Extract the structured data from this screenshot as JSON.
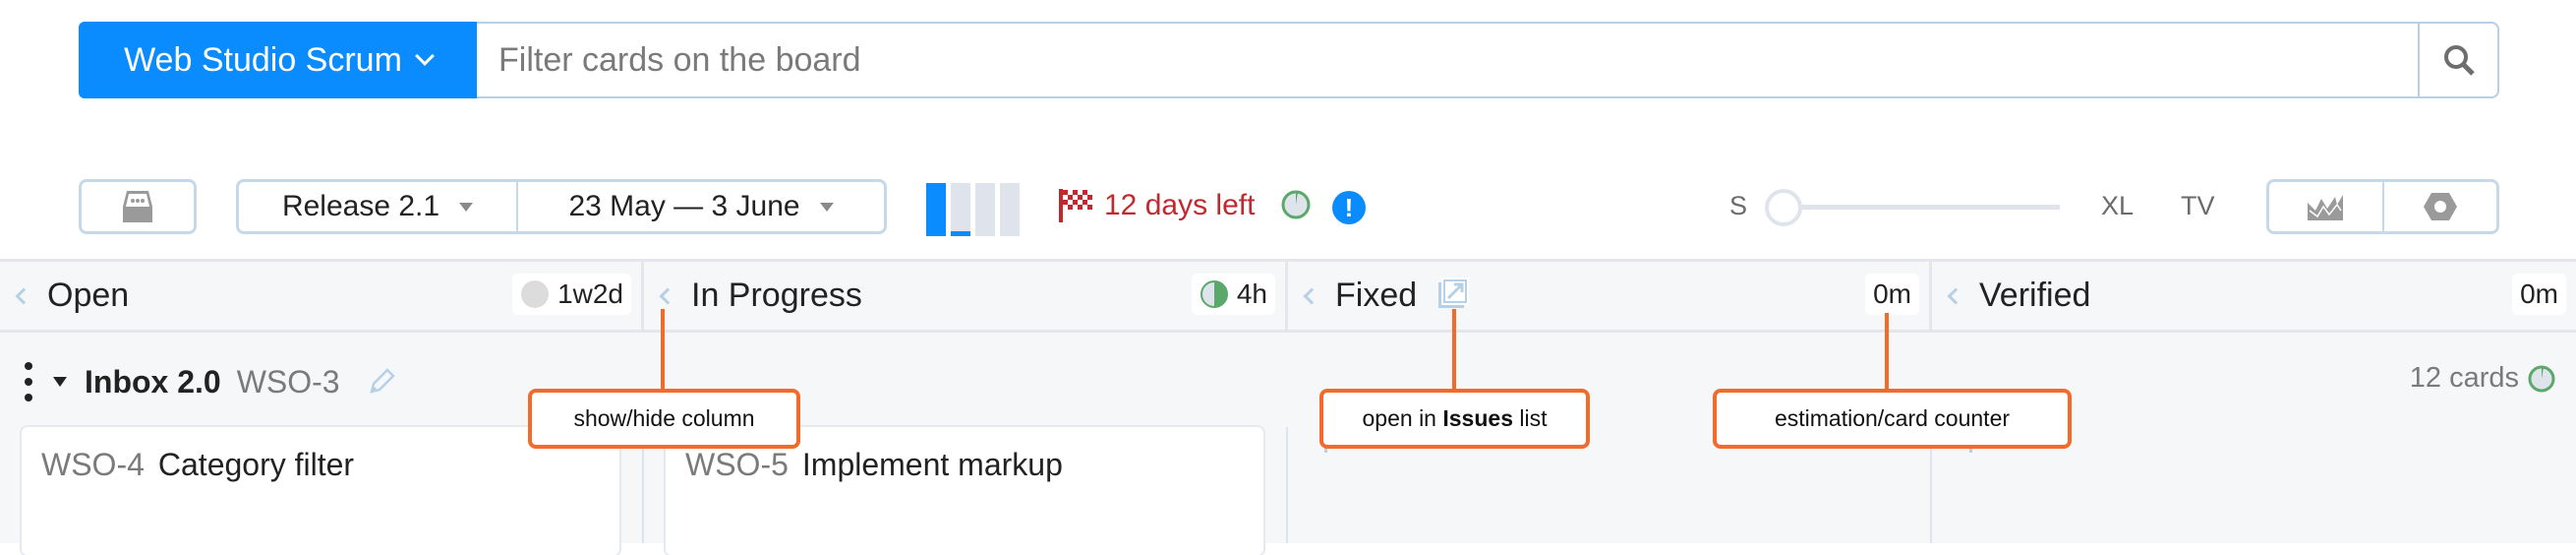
{
  "header": {
    "board_selector_label": "Web Studio Scrum",
    "search_placeholder": "Filter cards on the board",
    "search_value": ""
  },
  "toolbar": {
    "sprint_label": "Release 2.1",
    "date_range_label": "23 May — 3 June",
    "progress_bars": [
      1.0,
      0.1,
      0.0,
      0.0
    ],
    "days_left_label": "12 days left",
    "size_slider": {
      "min_label": "S",
      "max_label": "XL",
      "value_fraction": 0.0
    },
    "tv_label": "TV",
    "colors": {
      "accent": "#0a8cff",
      "days_left": "#c3282e",
      "pie": "#5aa86a"
    }
  },
  "columns": [
    {
      "title": "Open",
      "counter": "1w2d",
      "indicator": "grey-circle"
    },
    {
      "title": "In Progress",
      "counter": "4h",
      "indicator": "half-green-circle"
    },
    {
      "title": "Fixed",
      "counter": "0m",
      "indicator": null,
      "has_open_list_icon": true
    },
    {
      "title": "Verified",
      "counter": "0m",
      "indicator": null
    }
  ],
  "swimlane": {
    "name": "Inbox 2.0",
    "key": "WSO-3",
    "card_count_label": "12 cards"
  },
  "cards": [
    {
      "key": "WSO-4",
      "title": "Category filter"
    },
    {
      "key": "WSO-5",
      "title": "Implement markup"
    }
  ],
  "annotations": {
    "show_hide": "show/hide column",
    "open_issues_prefix": "open in ",
    "open_issues_bold": "Issues",
    "open_issues_suffix": " list",
    "estimation": "estimation/card counter"
  }
}
